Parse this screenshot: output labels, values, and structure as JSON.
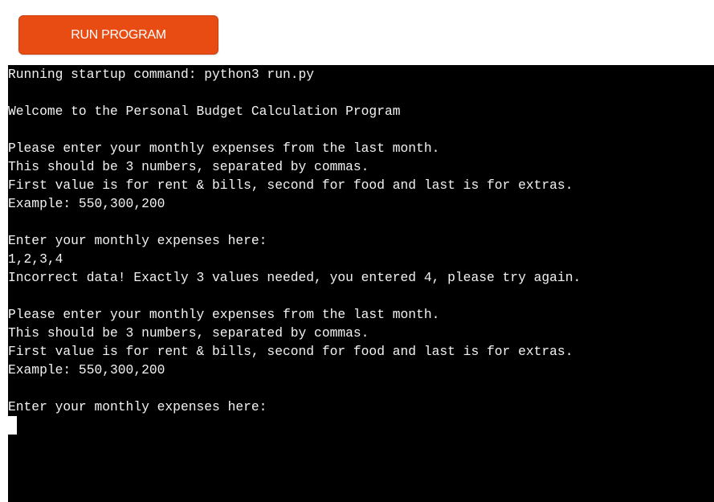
{
  "run_button": {
    "label": "RUN PROGRAM"
  },
  "terminal": {
    "lines": [
      "Running startup command: python3 run.py",
      "",
      "Welcome to the Personal Budget Calculation Program",
      "",
      "Please enter your monthly expenses from the last month.",
      "This should be 3 numbers, separated by commas.",
      "First value is for rent & bills, second for food and last is for extras.",
      "Example: 550,300,200",
      "",
      "Enter your monthly expenses here:",
      "1,2,3,4",
      "Incorrect data! Exactly 3 values needed, you entered 4, please try again.",
      "",
      "Please enter your monthly expenses from the last month.",
      "This should be 3 numbers, separated by commas.",
      "First value is for rent & bills, second for food and last is for extras.",
      "Example: 550,300,200",
      "",
      "Enter your monthly expenses here:"
    ]
  },
  "colors": {
    "button_background": "#e84c13",
    "terminal_background": "#000000",
    "terminal_text": "#f2f2f2"
  }
}
